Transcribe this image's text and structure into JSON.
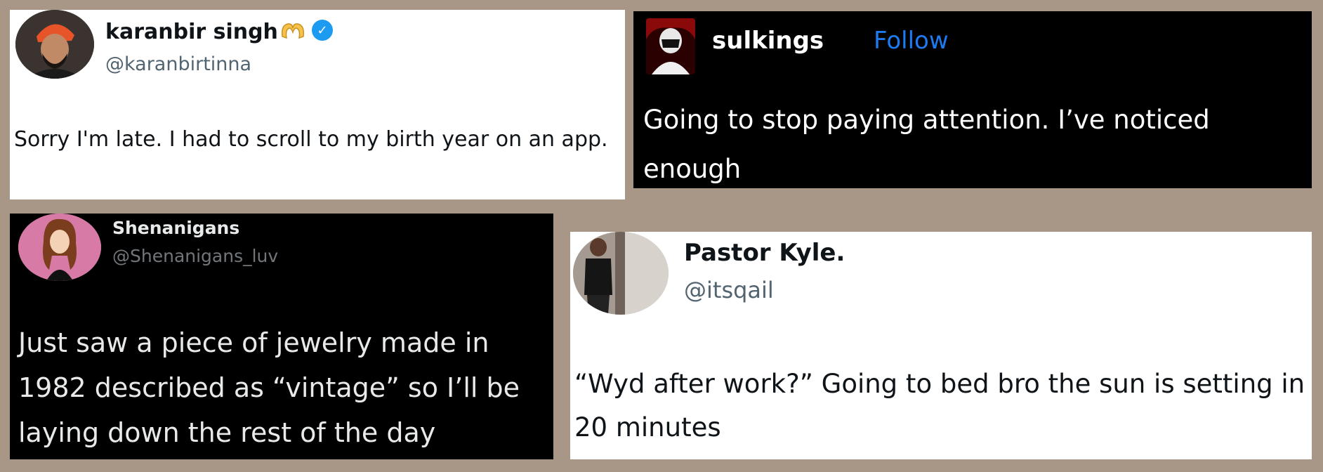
{
  "posts": [
    {
      "name": "karanbir singh",
      "handle": "@karanbirtinna",
      "badges": [
        "heart-hands-emoji",
        "verified-icon"
      ],
      "text": "Sorry I'm late. I had to scroll to my birth year on an app."
    },
    {
      "name": "sulkings",
      "follow_label": "Follow",
      "text": "Going to stop paying attention. I’ve noticed enough"
    },
    {
      "name": "Shenanigans",
      "handle": "@Shenanigans_luv",
      "text": "Just saw a piece of jewelry made in 1982 described as “vintage” so I’ll be laying down the rest of the day"
    },
    {
      "name": "Pastor Kyle.",
      "handle": "@itsqail",
      "text": "“Wyd after work?” Going to bed bro the sun is setting in 20 minutes"
    }
  ],
  "colors": {
    "background": "#a89686",
    "verified": "#1d9bf0",
    "follow": "#1d7bf2",
    "avatar_pink": "#d87aa6"
  }
}
